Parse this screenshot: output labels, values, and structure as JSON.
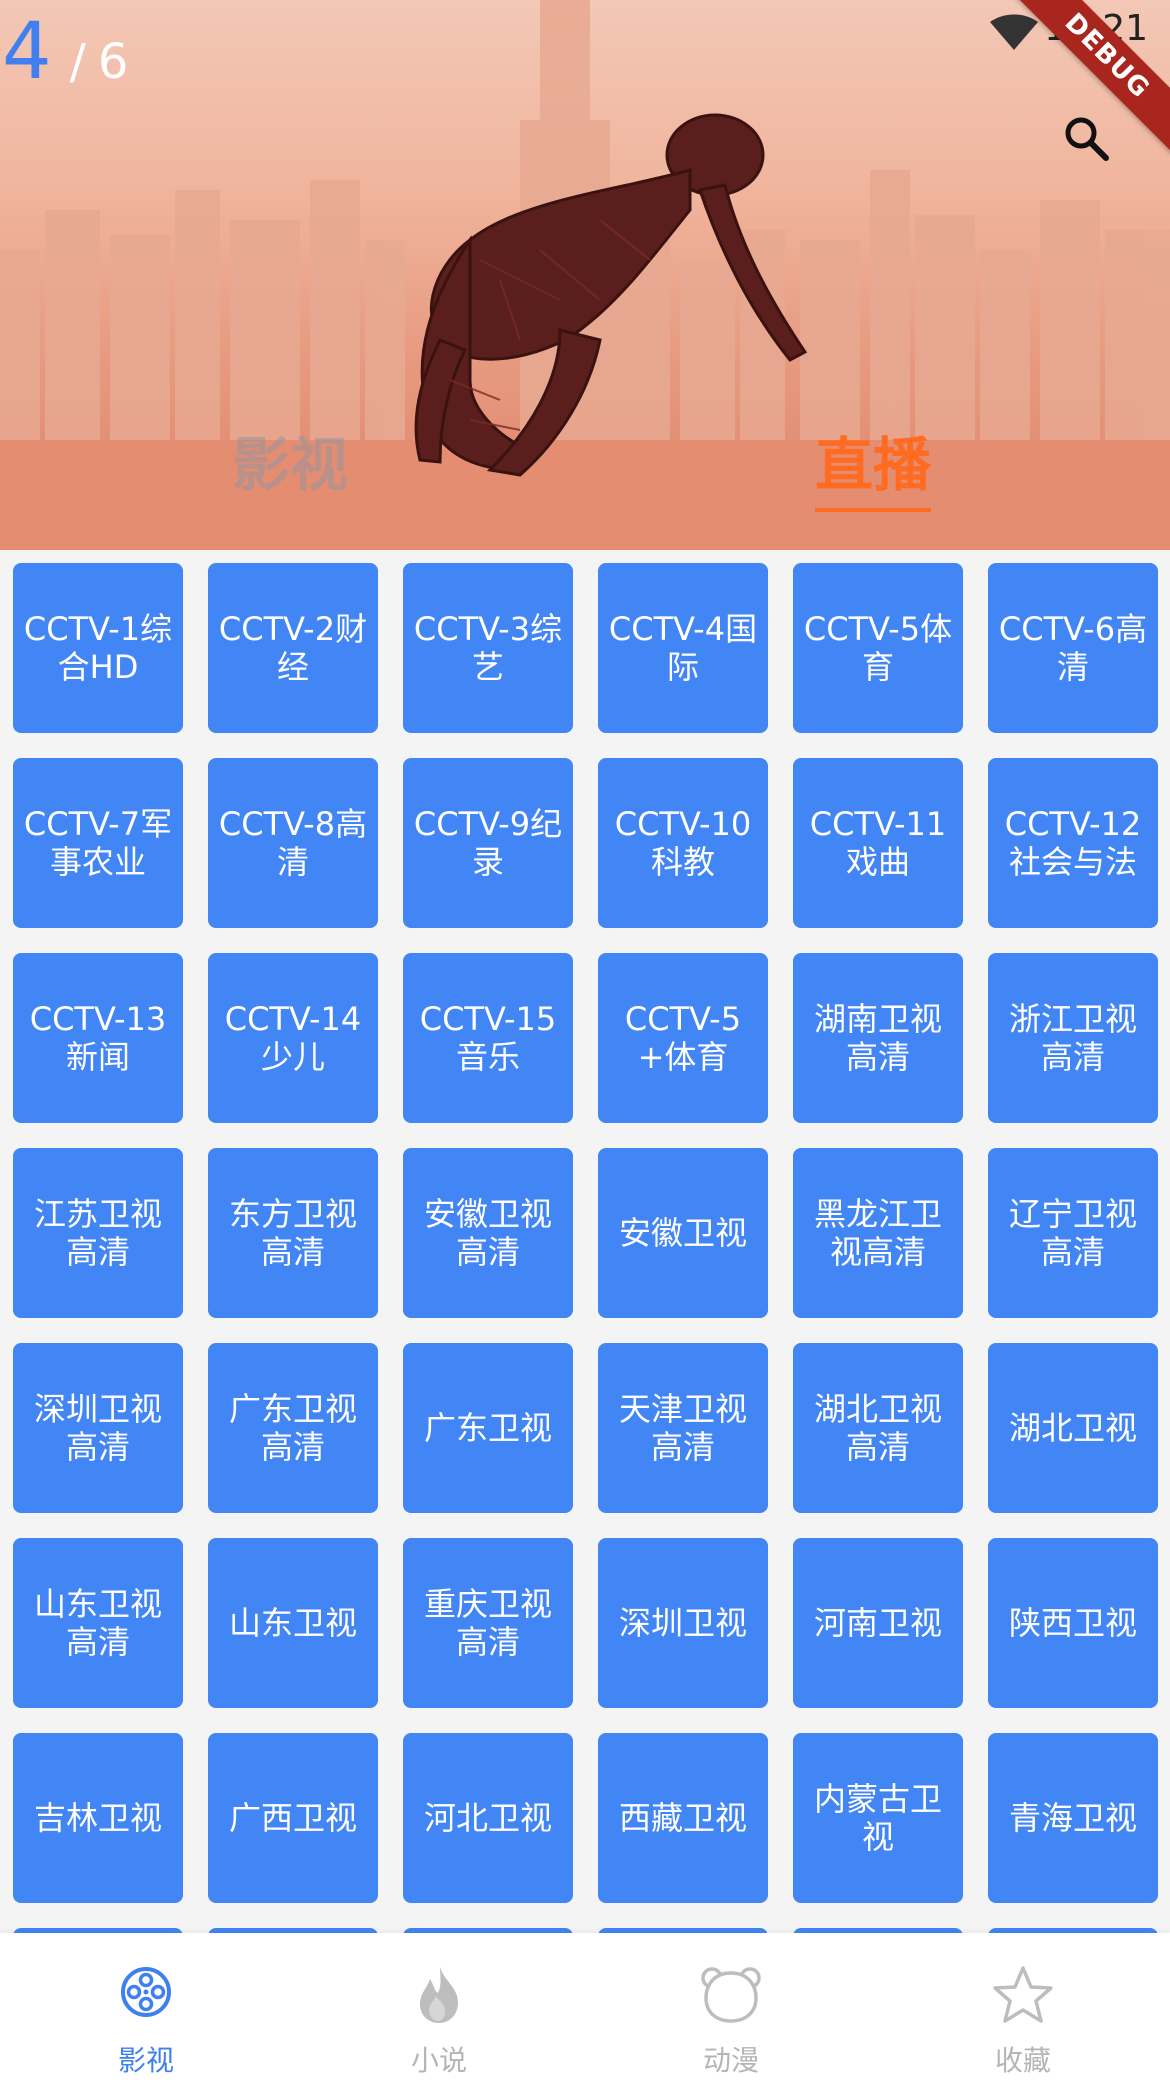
{
  "carousel": {
    "current": "4",
    "separator": "/",
    "total": "6"
  },
  "status_bar": {
    "time": "11:21",
    "debug_label": "DEBUG"
  },
  "hero_tabs": {
    "movie": "影视",
    "live": "直播",
    "active": "直播"
  },
  "colors": {
    "tile": "#4285f4",
    "accent": "#ff6b20",
    "nav_active": "#3f7ff0",
    "nav_inactive": "#b5b5b5"
  },
  "channels": [
    "CCTV-1综合HD",
    "CCTV-2财经",
    "CCTV-3综艺",
    "CCTV-4国际",
    "CCTV-5体育",
    "CCTV-6高清",
    "CCTV-7军事农业",
    "CCTV-8高清",
    "CCTV-9纪录",
    "CCTV-10科教",
    "CCTV-11戏曲",
    "CCTV-12社会与法",
    "CCTV-13新闻",
    "CCTV-14少儿",
    "CCTV-15音乐",
    "CCTV-5+体育",
    "湖南卫视高清",
    "浙江卫视高清",
    "江苏卫视高清",
    "东方卫视高清",
    "安徽卫视高清",
    "安徽卫视",
    "黑龙江卫视高清",
    "辽宁卫视高清",
    "深圳卫视高清",
    "广东卫视高清",
    "广东卫视",
    "天津卫视高清",
    "湖北卫视高清",
    "湖北卫视",
    "山东卫视高清",
    "山东卫视",
    "重庆卫视高清",
    "深圳卫视",
    "河南卫视",
    "陕西卫视",
    "吉林卫视",
    "广西卫视",
    "河北卫视",
    "西藏卫视",
    "内蒙古卫视",
    "青海卫视"
  ],
  "bottom_nav": [
    {
      "label": "影视",
      "icon": "film-reel-icon",
      "active": true
    },
    {
      "label": "小说",
      "icon": "flame-icon",
      "active": false
    },
    {
      "label": "动漫",
      "icon": "bear-icon",
      "active": false
    },
    {
      "label": "收藏",
      "icon": "star-icon",
      "active": false
    }
  ]
}
